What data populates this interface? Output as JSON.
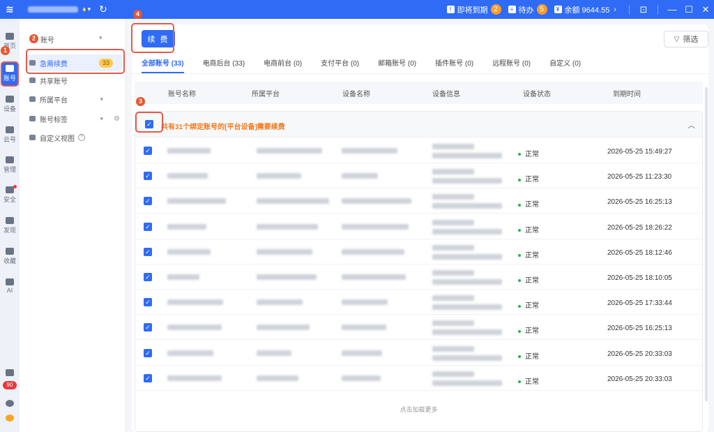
{
  "topbar": {
    "expiring_label": "即将到期",
    "expiring_count": "2",
    "todo_label": "待办",
    "todo_count": "5",
    "balance": "余额 9644.55"
  },
  "rail": {
    "items": [
      "首页",
      "账号",
      "设备",
      "云号",
      "管理",
      "安全",
      "发现",
      "收藏",
      "AI"
    ],
    "badge": "90"
  },
  "nav": {
    "header": "账号",
    "items": [
      {
        "label": "急需续费",
        "count": "33"
      },
      {
        "label": "共享账号"
      },
      {
        "label": "所属平台"
      },
      {
        "label": "账号标签"
      },
      {
        "label": "自定义视图"
      }
    ]
  },
  "steps": [
    "1",
    "2",
    "3",
    "4"
  ],
  "toolbar": {
    "renew_label": "续 费",
    "filter_label": "筛选"
  },
  "tabs": [
    "全部账号 (33)",
    "电商后台 (33)",
    "电商前台 (0)",
    "支付平台 (0)",
    "邮箱账号 (0)",
    "插件账号 (0)",
    "远程账号 (0)",
    "自定义 (0)"
  ],
  "table": {
    "headers": [
      "账号名称",
      "所属平台",
      "设备名称",
      "设备信息",
      "设备状态",
      "到期时间"
    ],
    "group_text": "共有31个绑定账号的[平台设备]需要续费",
    "rows": [
      {
        "status": "正常",
        "time": "2026-05-25 15:49:27"
      },
      {
        "status": "正常",
        "time": "2026-05-25 11:23:30"
      },
      {
        "status": "正常",
        "time": "2026-05-25 16:25:13"
      },
      {
        "status": "正常",
        "time": "2026-05-25 18:26:22"
      },
      {
        "status": "正常",
        "time": "2026-05-25 18:12:46"
      },
      {
        "status": "正常",
        "time": "2026-05-25 18:10:05"
      },
      {
        "status": "正常",
        "time": "2026-05-25 17:33:44"
      },
      {
        "status": "正常",
        "time": "2026-05-25 16:25:13"
      },
      {
        "status": "正常",
        "time": "2026-05-25 20:33:03"
      },
      {
        "status": "正常",
        "time": "2026-05-25 20:33:03"
      }
    ],
    "load_more": "点击加载更多"
  },
  "colors": {
    "accent": "#2f6bf5",
    "warning": "#f07a1e",
    "status_ok": "#2bb24c",
    "annotation": "#e45b4a"
  }
}
